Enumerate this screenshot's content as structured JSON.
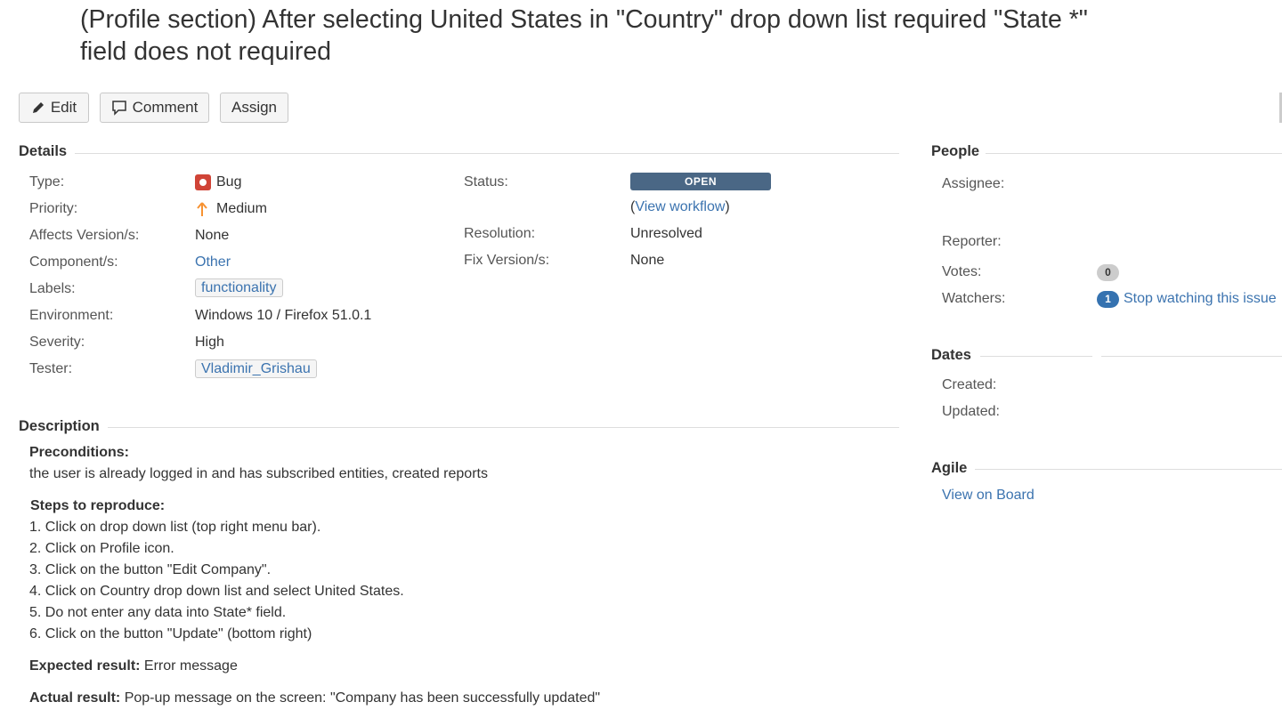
{
  "issue": {
    "title_line1": "(Profile section) After selecting United States in \"Country\" drop down list required \"State *\"",
    "title_line2": "field does not required"
  },
  "toolbar": {
    "edit_label": "Edit",
    "comment_label": "Comment",
    "assign_label": "Assign"
  },
  "details": {
    "heading": "Details",
    "type_label": "Type:",
    "type_value": "Bug",
    "priority_label": "Priority:",
    "priority_value": "Medium",
    "affects_label": "Affects Version/s:",
    "affects_value": "None",
    "components_label": "Component/s:",
    "components_value": "Other",
    "labels_label": "Labels:",
    "labels_value": "functionality",
    "environment_label": "Environment:",
    "environment_value": "Windows 10 / Firefox 51.0.1",
    "severity_label": "Severity:",
    "severity_value": "High",
    "tester_label": "Tester:",
    "tester_value": "Vladimir_Grishau",
    "status_label": "Status:",
    "status_value": "OPEN",
    "workflow_open": "(",
    "workflow_link": "View workflow",
    "workflow_close": ")",
    "resolution_label": "Resolution:",
    "resolution_value": "Unresolved",
    "fix_label": "Fix Version/s:",
    "fix_value": "None"
  },
  "description": {
    "heading": "Description",
    "preconditions_heading": "Preconditions:",
    "preconditions_text": "the user is already logged in and has subscribed entities, created reports",
    "steps_heading": "Steps to reproduce:",
    "steps": [
      "1. Click on drop down list (top right menu bar).",
      "2. Click on Profile icon.",
      "3. Click on the button \"Edit Company\".",
      "4. Click on Country drop down list and select United States.",
      "5. Do not enter any data into State* field.",
      "6. Click on the button \"Update\" (bottom right)"
    ],
    "expected_label": "Expected result:",
    "expected_text": " Error message",
    "actual_label": "Actual result:",
    "actual_text": " Pop-up message on the screen: \"Company has been successfully updated\""
  },
  "people": {
    "heading": "People",
    "assignee_label": "Assignee:",
    "reporter_label": "Reporter:",
    "votes_label": "Votes:",
    "votes_count": "0",
    "watchers_label": "Watchers:",
    "watchers_count": "1",
    "watch_link": "Stop watching this issue"
  },
  "dates": {
    "heading": "Dates",
    "created_label": "Created:",
    "updated_label": "Updated:"
  },
  "agile": {
    "heading": "Agile",
    "board_link": "View on Board"
  },
  "colors": {
    "link": "#3b73af",
    "status_open": "#4a6785",
    "bug_red": "#d04437",
    "priority_orange": "#f79232",
    "watch_badge": "#3572b0"
  }
}
